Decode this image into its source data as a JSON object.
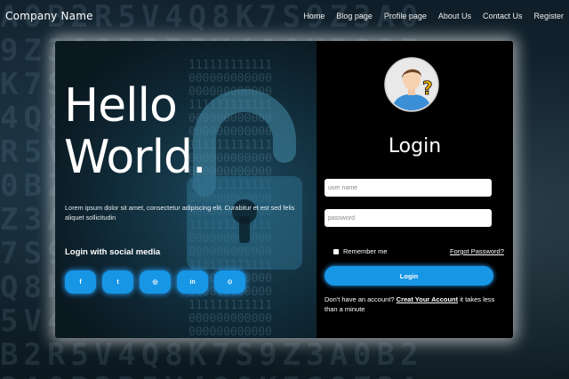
{
  "navbar": {
    "brand": "Company Name",
    "links": [
      "Home",
      "Blog page",
      "Profile page",
      "About Us",
      "Contact Us",
      "Register"
    ]
  },
  "hero": {
    "title_line1": "Hello",
    "title_line2": "World.",
    "description": "Lorem ipsum dolor sit amet, consectetur adipiscing elit. Curabitur et est sed felis aliquet sollicitudin",
    "social_title": "Login with social media",
    "social_buttons": [
      {
        "icon": "facebook-icon",
        "glyph": "f"
      },
      {
        "icon": "twitter-icon",
        "glyph": "t"
      },
      {
        "icon": "instagram-icon",
        "glyph": "◎"
      },
      {
        "icon": "linkedin-icon",
        "glyph": "in"
      },
      {
        "icon": "github-icon",
        "glyph": "⊙"
      }
    ]
  },
  "login": {
    "title": "Login",
    "username_placeholder": "user name",
    "password_placeholder": "password",
    "remember_label": "Remember me",
    "forgot_label": "Forgot Password?",
    "button_label": "Login",
    "signup_prefix": "Don't have an account?",
    "signup_link": "Creat Your Account",
    "signup_suffix": "it takes less than a minute"
  },
  "colors": {
    "accent": "#1796e6",
    "card_left": "#12303f",
    "card_right": "#000000"
  }
}
